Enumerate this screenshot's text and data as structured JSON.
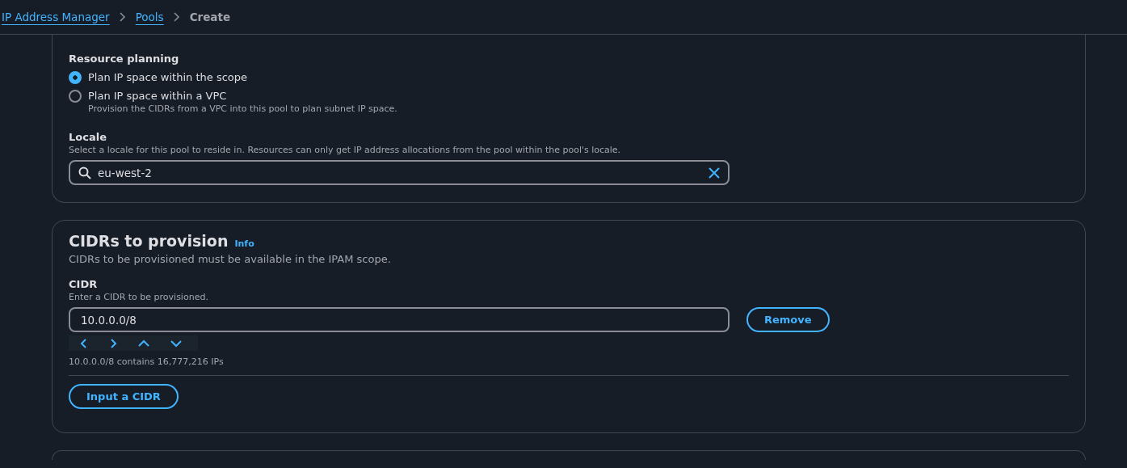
{
  "breadcrumbs": [
    {
      "label": "IP Address Manager",
      "kind": "link"
    },
    {
      "label": "Pools",
      "kind": "link"
    },
    {
      "label": "Create",
      "kind": "current"
    }
  ],
  "resource_planning": {
    "label": "Resource planning",
    "options": [
      {
        "label": "Plan IP space within the scope",
        "selected": true
      },
      {
        "label": "Plan IP space within a VPC",
        "selected": false,
        "description": "Provision the CIDRs from a VPC into this pool to plan subnet IP space."
      }
    ]
  },
  "locale": {
    "label": "Locale",
    "description": "Select a locale for this pool to reside in. Resources can only get IP address allocations from the pool within the pool's locale.",
    "value": "eu-west-2"
  },
  "cidrs": {
    "title": "CIDRs to provision",
    "info": "Info",
    "description": "CIDRs to be provisioned must be available in the IPAM scope.",
    "field_label": "CIDR",
    "field_description": "Enter a CIDR to be provisioned.",
    "value": "10.0.0.0/8",
    "remove_button": "Remove",
    "summary": "10.0.0.0/8 contains 16,777,216 IPs",
    "add_button": "Input a CIDR"
  }
}
